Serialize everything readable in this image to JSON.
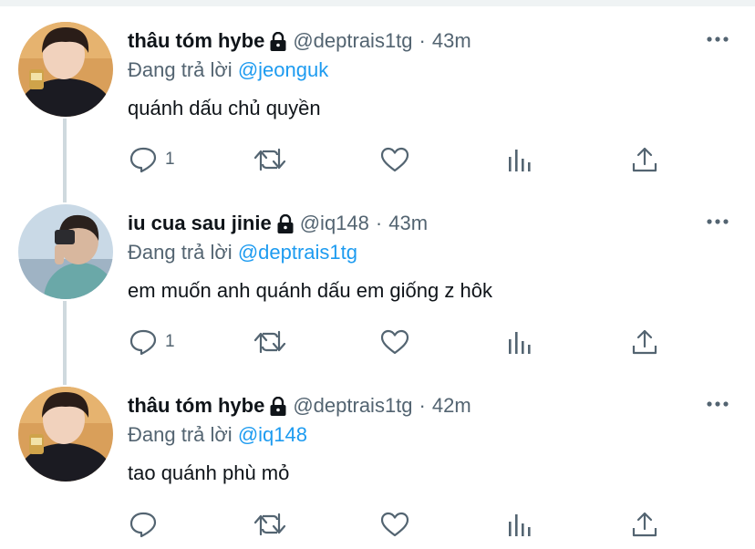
{
  "tweets": [
    {
      "name": "thâu tóm hybe",
      "handle": "@deptrais1tg",
      "dot": "·",
      "time": "43m",
      "reply_prefix": "Đang trả lời",
      "reply_to": "@jeonguk",
      "text": "quánh dấu chủ quyền",
      "reply_count": "1",
      "avatar": "avatar-1"
    },
    {
      "name": "iu cua sau jinie",
      "handle": "@iq148",
      "dot": "·",
      "time": "43m",
      "reply_prefix": "Đang trả lời",
      "reply_to": "@deptrais1tg",
      "text": "em muốn anh quánh dấu em giống z hôk",
      "reply_count": "1",
      "avatar": "avatar-2"
    },
    {
      "name": "thâu tóm hybe",
      "handle": "@deptrais1tg",
      "dot": "·",
      "time": "42m",
      "reply_prefix": "Đang trả lời",
      "reply_to": "@iq148",
      "text": "tao quánh phù mỏ",
      "reply_count": "",
      "avatar": "avatar-1"
    }
  ],
  "icons": [
    "lock-icon",
    "more-icon",
    "reply-icon",
    "retweet-icon",
    "like-icon",
    "analytics-icon",
    "share-icon"
  ],
  "colors": {
    "text": "#0f1419",
    "secondary": "#536471",
    "link": "#1d9bf0",
    "thread": "#cfd9de"
  }
}
